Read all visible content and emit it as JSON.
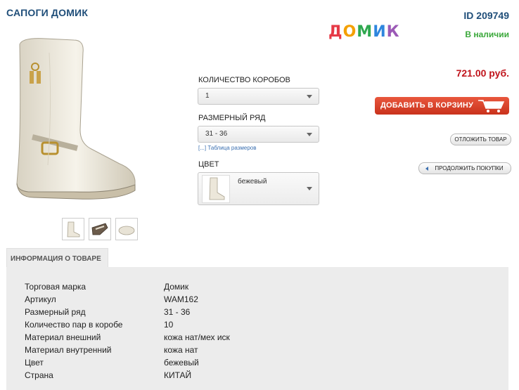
{
  "product": {
    "title": "САПОГИ ДОМИК",
    "id_label": "ID 209749",
    "brand_logo_letters": [
      "Д",
      "О",
      "М",
      "И",
      "К"
    ],
    "brand_logo_colors": [
      "#e63946",
      "#f4a000",
      "#2fa84f",
      "#2e86de",
      "#9b59b6"
    ],
    "stock_status": "В наличии",
    "price": "721.00 руб."
  },
  "options": {
    "boxes_label": "КОЛИЧЕСТВО КОРОБОВ",
    "boxes_value": "1",
    "size_label": "РАЗМЕРНЫЙ РЯД",
    "size_value": "31 - 36",
    "size_table_link": "[...] Таблица размеров",
    "color_label": "ЦВЕТ",
    "color_value": "бежевый"
  },
  "actions": {
    "add_to_cart": "ДОБАВИТЬ В КОРЗИНУ",
    "defer": "ОТЛОЖИТЬ ТОВАР",
    "continue": "ПРОДОЛЖИТЬ ПОКУПКИ"
  },
  "info": {
    "tab_label": "ИНФОРМАЦИЯ О ТОВАРЕ",
    "rows": [
      {
        "key": "Торговая марка",
        "value": "Домик"
      },
      {
        "key": "Артикул",
        "value": "WAM162"
      },
      {
        "key": "Размерный ряд",
        "value": "31 - 36"
      },
      {
        "key": "Количество пар в коробе",
        "value": "10"
      },
      {
        "key": "Материал внешний",
        "value": "кожа нат/мех иск"
      },
      {
        "key": "Материал внутренний",
        "value": "кожа нат"
      },
      {
        "key": "Цвет",
        "value": "бежевый"
      },
      {
        "key": "Страна",
        "value": "КИТАЙ"
      }
    ]
  },
  "colors": {
    "title_blue": "#1f4e79",
    "stock_green": "#3aa83a",
    "price_red": "#c0141c",
    "cart_button": "#d9432a"
  }
}
